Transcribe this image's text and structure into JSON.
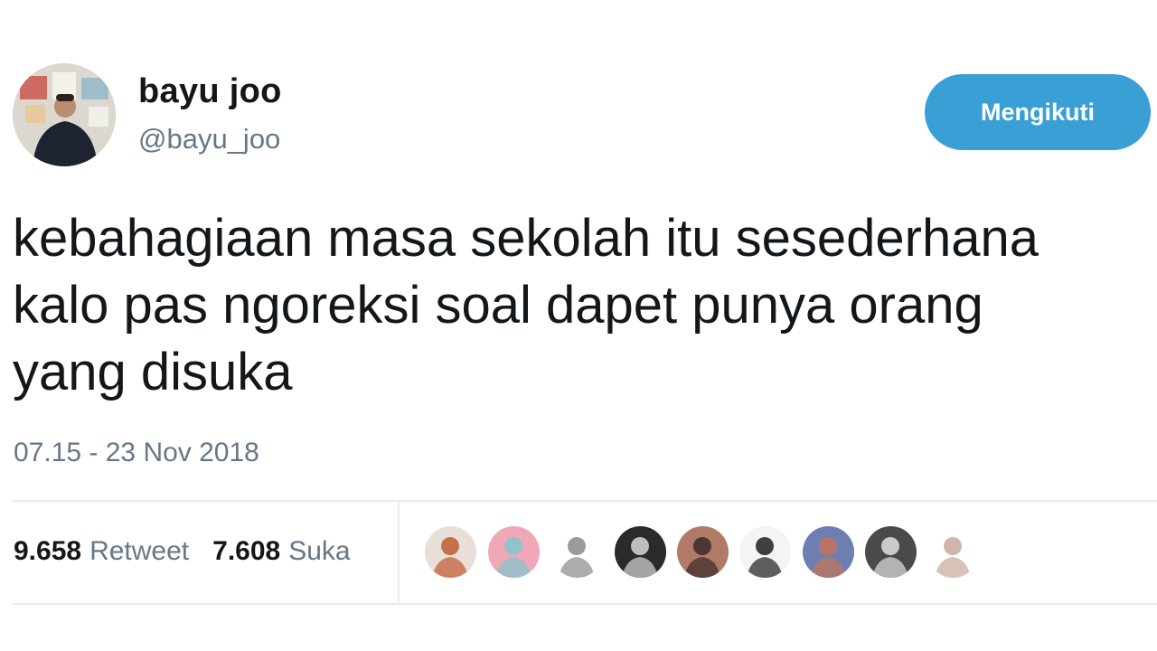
{
  "user": {
    "display_name": "bayu joo",
    "handle": "@bayu_joo",
    "avatar_icon": "profile-photo"
  },
  "follow_button": {
    "label": "Mengikuti",
    "color": "#3a9fd4"
  },
  "tweet": {
    "text": "kebahagiaan masa sekolah itu sesederhana\nkalo pas ngoreksi soal dapet punya orang\nyang disuka",
    "timestamp": "07.15 - 23 Nov 2018"
  },
  "stats": {
    "retweet_count": "9.658",
    "retweet_label": "Retweet",
    "like_count": "7.608",
    "like_label": "Suka"
  },
  "likers": [
    {
      "icon": "user-avatar-1",
      "colors": [
        "#e8e0d8",
        "#c05a30"
      ]
    },
    {
      "icon": "user-avatar-2",
      "colors": [
        "#f2a7b6",
        "#7fc8d0"
      ]
    },
    {
      "icon": "user-avatar-3",
      "colors": [
        "#ffffff",
        "#8a8a8a"
      ]
    },
    {
      "icon": "user-avatar-4",
      "colors": [
        "#2a2a2a",
        "#d8d8d8"
      ]
    },
    {
      "icon": "user-avatar-5",
      "colors": [
        "#b07a66",
        "#3a2a28"
      ]
    },
    {
      "icon": "user-avatar-6",
      "colors": [
        "#f4f4f4",
        "#1e1e1e"
      ]
    },
    {
      "icon": "user-avatar-7",
      "colors": [
        "#6d7fb0",
        "#c4735a"
      ]
    },
    {
      "icon": "user-avatar-8",
      "colors": [
        "#4a4a4a",
        "#e0e0e0"
      ]
    },
    {
      "icon": "user-avatar-9",
      "colors": [
        "#ffffff",
        "#c8a89a"
      ]
    }
  ]
}
